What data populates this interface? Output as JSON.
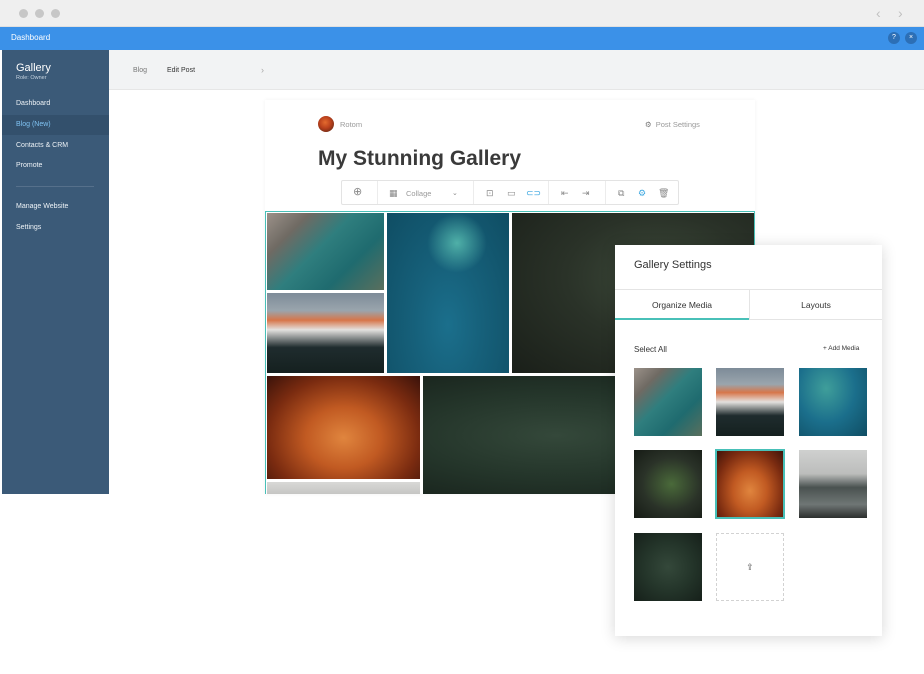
{
  "window": {
    "nav_back": "‹",
    "nav_forward": "›"
  },
  "topbar": {
    "title": "Dashboard",
    "help": "?",
    "close": "×"
  },
  "sidebar": {
    "brand": "Gallery",
    "role": "Role: Owner",
    "items": [
      {
        "label": "Dashboard"
      },
      {
        "label": "Blog (New)",
        "active": true
      },
      {
        "label": "Contacts & CRM"
      },
      {
        "label": "Promote"
      },
      {
        "label": "Manage Website"
      },
      {
        "label": "Settings"
      }
    ]
  },
  "breadcrumb": {
    "parent": "Blog",
    "separator": "›",
    "current": "Edit Post"
  },
  "post": {
    "author": "Rotom",
    "settings_label": "Post Settings",
    "title": "My Stunning Gallery"
  },
  "toolbar": {
    "layout_select": "Collage",
    "icons": [
      "add-icon",
      "layout-icon",
      "chevron-down-icon",
      "align-top-icon",
      "align-middle-icon",
      "align-full-icon",
      "align-left-icon",
      "align-right-icon",
      "replace-icon",
      "settings-icon",
      "delete-icon"
    ]
  },
  "gallery_panel": {
    "title": "Gallery Settings",
    "tabs": [
      {
        "label": "Organize Media",
        "active": true
      },
      {
        "label": "Layouts"
      }
    ],
    "select_all": "Select All",
    "add_media": "+ Add Media",
    "thumbnails": [
      {
        "subject": "river-aerial"
      },
      {
        "subject": "mountain-sunset"
      },
      {
        "subject": "lake-aerial"
      },
      {
        "subject": "fern"
      },
      {
        "subject": "canyon",
        "selected": true
      },
      {
        "subject": "kayak-lake"
      },
      {
        "subject": "forest"
      }
    ],
    "upload_icon": "upload-icon"
  },
  "colors": {
    "accent": "#3b91e8",
    "sidebar": "#3b5a78",
    "selection": "#48c0b8"
  }
}
